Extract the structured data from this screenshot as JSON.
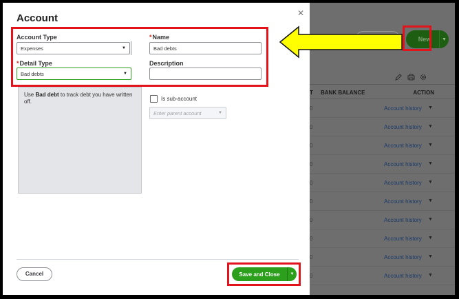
{
  "dialog": {
    "title": "Account",
    "account_type": {
      "label": "Account Type",
      "value": "Expenses"
    },
    "name": {
      "label": "Name",
      "value": "Bad debts"
    },
    "detail_type": {
      "label": "Detail Type",
      "value": "Bad debts"
    },
    "description": {
      "label": "Description",
      "value": ""
    },
    "help_text_bold": "Bad debt",
    "help_text_pre": "Use ",
    "help_text_post": " to track debt you have written off.",
    "sub_account": {
      "label": "Is sub-account",
      "checked": false,
      "placeholder": "Enter parent account"
    },
    "cancel_label": "Cancel",
    "save_label": "Save and Close"
  },
  "background": {
    "new_button": "New",
    "columns": {
      "partial": "T",
      "bank_balance": "BANK BALANCE",
      "action": "ACTION"
    },
    "row_action": "Account history",
    "rows": 10
  },
  "colors": {
    "accent_green": "#2ca01c",
    "annotation_red": "#e3131c",
    "arrow_yellow": "#ffff00"
  },
  "icons": [
    "close-icon",
    "dropdown-caret-icon",
    "pencil-icon",
    "printer-icon",
    "gear-icon",
    "annotation-arrow-icon"
  ]
}
